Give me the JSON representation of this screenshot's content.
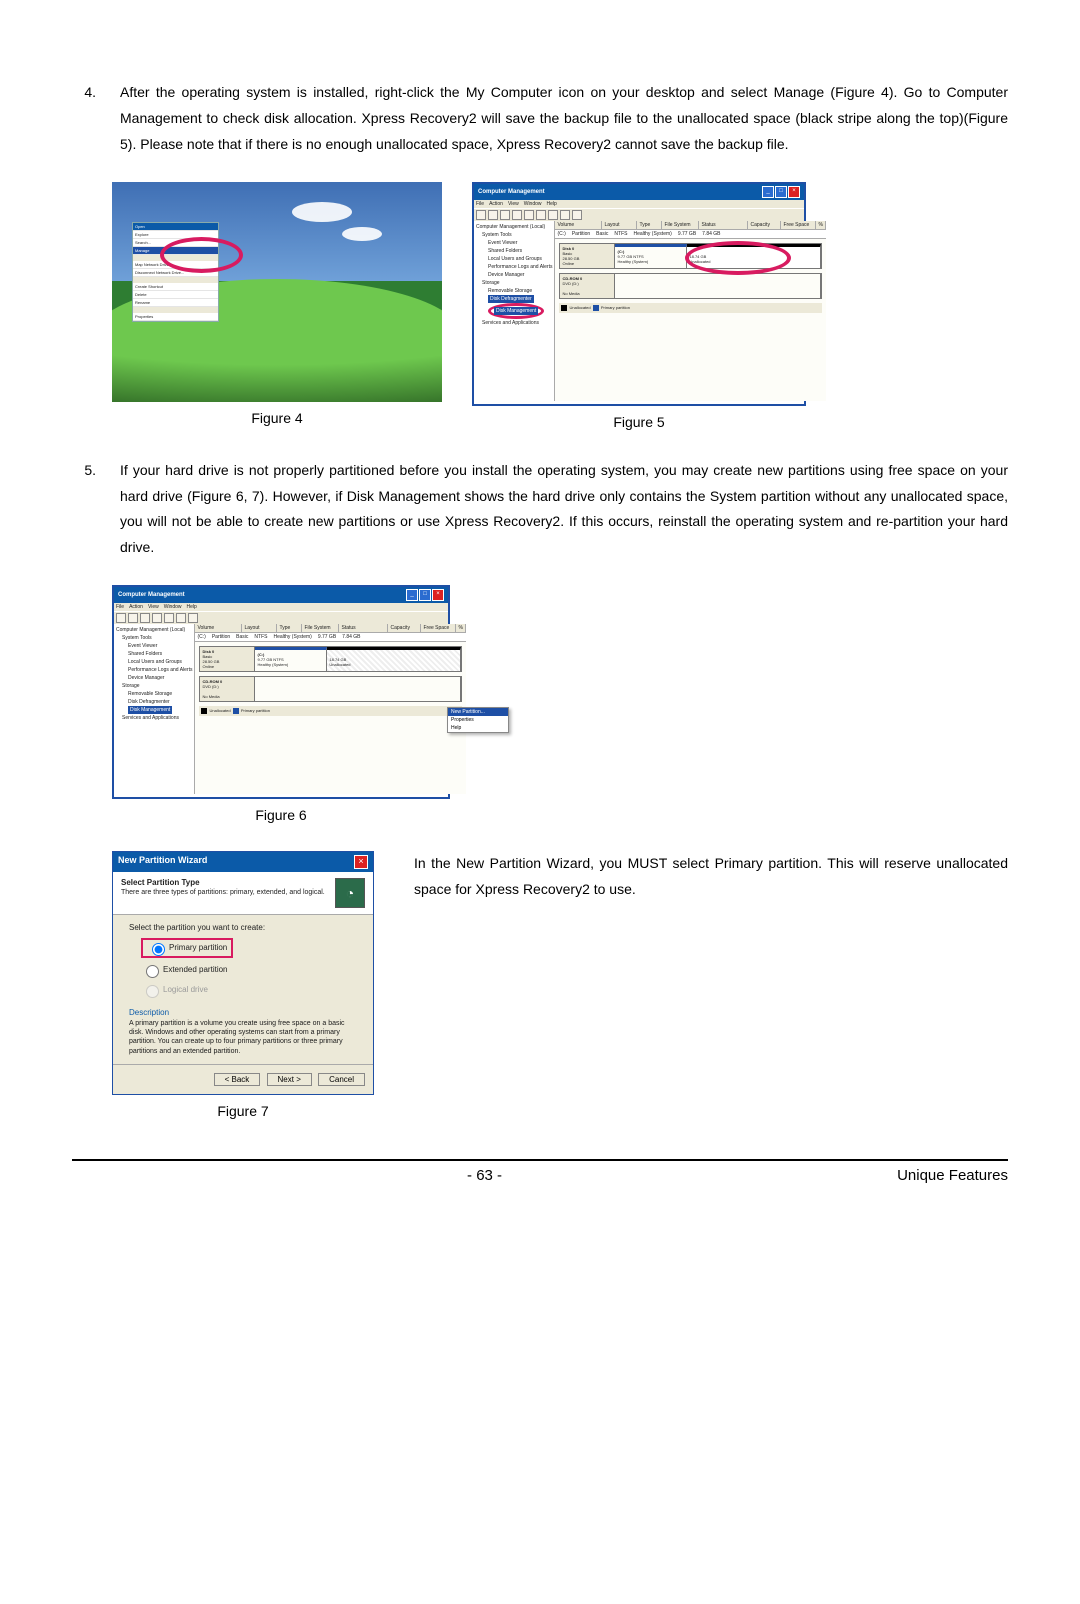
{
  "step4": {
    "num": "4.",
    "text_a": "After the operating system is installed, right-click the ",
    "my_computer": "My Computer",
    "text_b": " icon on your desktop and select ",
    "manage": "Manage",
    "text_c": " (Figure 4). Go to ",
    "cm": "Computer Management",
    "text_d": " to check disk allocation. Xpress Recovery2 will save the backup file to the unallocated space (black stripe along the top)(Figure 5). Please note that if there is no enough unallocated space, Xpress Recovery2 cannot save the backup file."
  },
  "fig4": {
    "caption": "Figure 4",
    "menu_hdr": "Open",
    "menu_items": [
      "Explore",
      "Search...",
      "Manage",
      "Map Network Drive...",
      "Disconnect Network Drive...",
      "",
      "Create Shortcut",
      "Delete",
      "Rename",
      "",
      "Properties"
    ]
  },
  "fig5": {
    "caption": "Figure 5",
    "title": "Computer Management",
    "menubar": [
      "File",
      "Action",
      "View",
      "Window",
      "Help"
    ],
    "tree": {
      "root": "Computer Management (Local)",
      "system_tools": "System Tools",
      "event_viewer": "Event Viewer",
      "shared": "Shared Folders",
      "users": "Local Users and Groups",
      "perf": "Performance Logs and Alerts",
      "devmgr": "Device Manager",
      "storage": "Storage",
      "removable": "Removable Storage",
      "defrag": "Disk Defragmenter",
      "diskmgmt": "Disk Management",
      "services": "Services and Applications"
    },
    "tbl_hdr": [
      "Volume",
      "Layout",
      "Type",
      "File System",
      "Status",
      "Capacity",
      "Free Space",
      "%"
    ],
    "vol_row": [
      "(C:)",
      "Partition",
      "Basic",
      "NTFS",
      "Healthy (System)",
      "9.77 GB",
      "7.84 GB",
      ""
    ],
    "disk0": {
      "name": "Disk 0",
      "sub": "Basic",
      "size": "28.50 GB",
      "state": "Online"
    },
    "part_c": {
      "name": "(C:)",
      "size": "9.77 GB NTFS",
      "state": "Healthy (System)"
    },
    "part_u": {
      "size": "18.74 GB",
      "state": "Unallocated"
    },
    "cdrom": {
      "name": "CD-ROM 0",
      "sub": "DVD (D:)",
      "state": "No Media"
    },
    "legend": {
      "un": "Unallocated",
      "pr": "Primary partition"
    }
  },
  "step5": {
    "num": "5.",
    "text_a": "If your hard drive is not properly partitioned before you install the operating system, you may create new partitions using free space on your hard drive (Figure 6, 7). However, if ",
    "dm": "Disk Management",
    "text_b": " shows the hard drive only contains the System partition without any unallocated space, you will not be able to create new partitions or use Xpress Recovery2. If this occurs, reinstall the operating system and re-partition your hard drive."
  },
  "fig6": {
    "caption": "Figure 6",
    "title": "Computer Management",
    "popup": [
      "New Partition...",
      "Properties",
      "Help"
    ]
  },
  "fig7": {
    "caption": "Figure 7",
    "wizard": {
      "title": "New Partition Wizard",
      "h1": "Select Partition Type",
      "h2": "There are three types of partitions: primary, extended, and logical.",
      "q": "Select the partition you want to create:",
      "opt1": "Primary partition",
      "opt2": "Extended partition",
      "opt3": "Logical drive",
      "desc_h": "Description",
      "desc": "A primary partition is a volume you create using free space on a basic disk. Windows and other operating systems can start from a primary partition. You can create up to four primary partitions or three primary partitions and an extended partition.",
      "back": "< Back",
      "next": "Next >",
      "cancel": "Cancel"
    },
    "side_a": "In the New Partition Wizard, you MUST select ",
    "side_b": "Primary partition",
    "side_c": ". This will reserve unallocated space for Xpress Recovery2 to use."
  },
  "footer": {
    "page": "- 63 -",
    "section": "Unique Features"
  }
}
